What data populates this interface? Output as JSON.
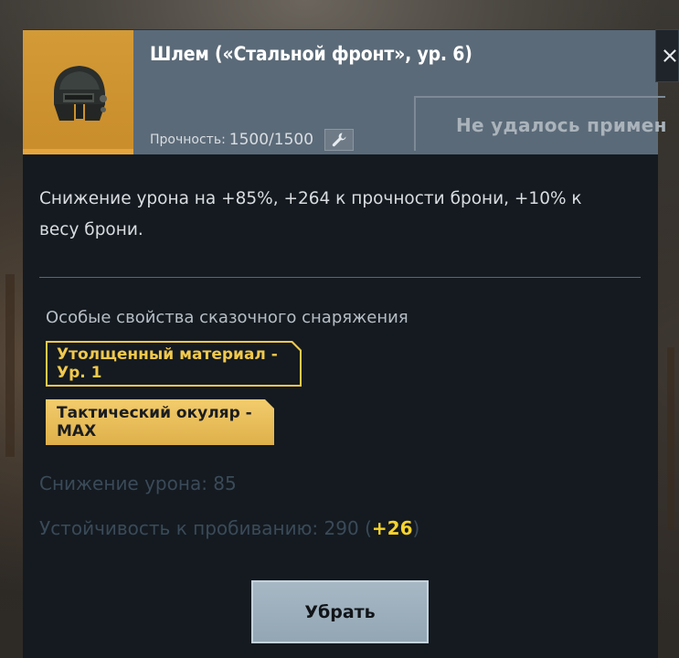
{
  "item": {
    "title": "Шлем («Стальной фронт», ур. 6)",
    "durability_label": "Прочность:",
    "durability_value": "1500/1500",
    "icon": "helmet-icon",
    "rarity_color": "#d39a37"
  },
  "apply_status": "Не удалось применит",
  "description": "Снижение урона на +85%, +264 к прочности брони, +10% к весу брони.",
  "perks": {
    "heading": "Особые свойства сказочного снаряжения",
    "tags": [
      {
        "label": "Утолщенный материал - Ур. 1",
        "style": "outlined"
      },
      {
        "label": "Тактический окуляр - MAX",
        "style": "filled"
      }
    ]
  },
  "stats": {
    "damage_reduction_label": "Снижение урона:",
    "damage_reduction_value": "85",
    "penetration_label": "Устойчивость к пробиванию:",
    "penetration_value": "290",
    "penetration_open": "(",
    "penetration_bonus": "+26",
    "penetration_close": ")"
  },
  "actions": {
    "remove_label": "Убрать",
    "repair_icon": "wrench-icon",
    "close_icon": "close-icon"
  },
  "colors": {
    "panel": "#141a20",
    "header": "#5b6a78",
    "accent_gold": "#f2c94c",
    "bonus_yellow": "#f6d32d",
    "button": "#a7b8c5"
  }
}
